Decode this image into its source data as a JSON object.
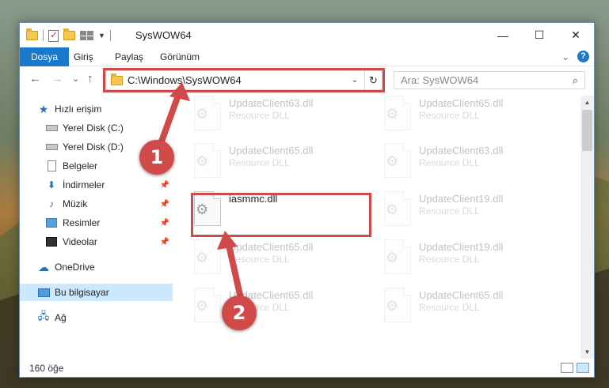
{
  "titlebar": {
    "title": "SysWOW64",
    "minimize": "—",
    "maximize": "☐",
    "close": "✕"
  },
  "ribbon": {
    "tabs": [
      "Dosya",
      "Giriş",
      "Paylaş",
      "Görünüm"
    ],
    "expand": "⌄",
    "help": "?"
  },
  "navigation": {
    "back": "←",
    "forward": "→",
    "recent": "⌄",
    "up": "↑",
    "address": "C:\\Windows\\SysWOW64",
    "address_caret": "⌄",
    "refresh": "↻",
    "search_placeholder": "Ara: SysWOW64",
    "search_icon": "⌕"
  },
  "sidebar": {
    "items": [
      {
        "label": "Hızlı erişim",
        "icon": "star-icon"
      },
      {
        "label": "Yerel Disk (C:)",
        "icon": "drive-icon"
      },
      {
        "label": "Yerel Disk (D:)",
        "icon": "drive-icon"
      },
      {
        "label": "Belgeler",
        "icon": "documents-icon"
      },
      {
        "label": "İndirmeler",
        "icon": "downloads-icon"
      },
      {
        "label": "Müzik",
        "icon": "music-icon"
      },
      {
        "label": "Resimler",
        "icon": "pictures-icon"
      },
      {
        "label": "Videolar",
        "icon": "videos-icon"
      },
      {
        "label": "OneDrive",
        "icon": "cloud-icon"
      },
      {
        "label": "Bu bilgisayar",
        "icon": "computer-icon"
      },
      {
        "label": "Ağ",
        "icon": "network-icon"
      }
    ],
    "pin": "📌"
  },
  "files": [
    {
      "name": "UpdateClient63.dll",
      "type": "Resource DLL"
    },
    {
      "name": "UpdateClient65.dll",
      "type": "Resource DLL"
    },
    {
      "name": "UpdateClient65.dll",
      "type": "Resource DLL"
    },
    {
      "name": "UpdateClient63.dll",
      "type": "Resource DLL"
    },
    {
      "name": "iasmmc.dll",
      "type": ""
    },
    {
      "name": "UpdateClient19.dll",
      "type": "Resource DLL"
    },
    {
      "name": "UpdateClient65.dll",
      "type": "Resource DLL"
    },
    {
      "name": "UpdateClient19.dll",
      "type": "Resource DLL"
    },
    {
      "name": "UpdateClient65.dll",
      "type": "Resource DLL"
    },
    {
      "name": "UpdateClient65.dll",
      "type": "Resource DLL"
    }
  ],
  "status": {
    "count": "160 öğe"
  },
  "callouts": [
    "1",
    "2"
  ],
  "colors": {
    "accent": "#1979ca",
    "highlight": "#d14a4a",
    "selected": "#cce8ff"
  }
}
